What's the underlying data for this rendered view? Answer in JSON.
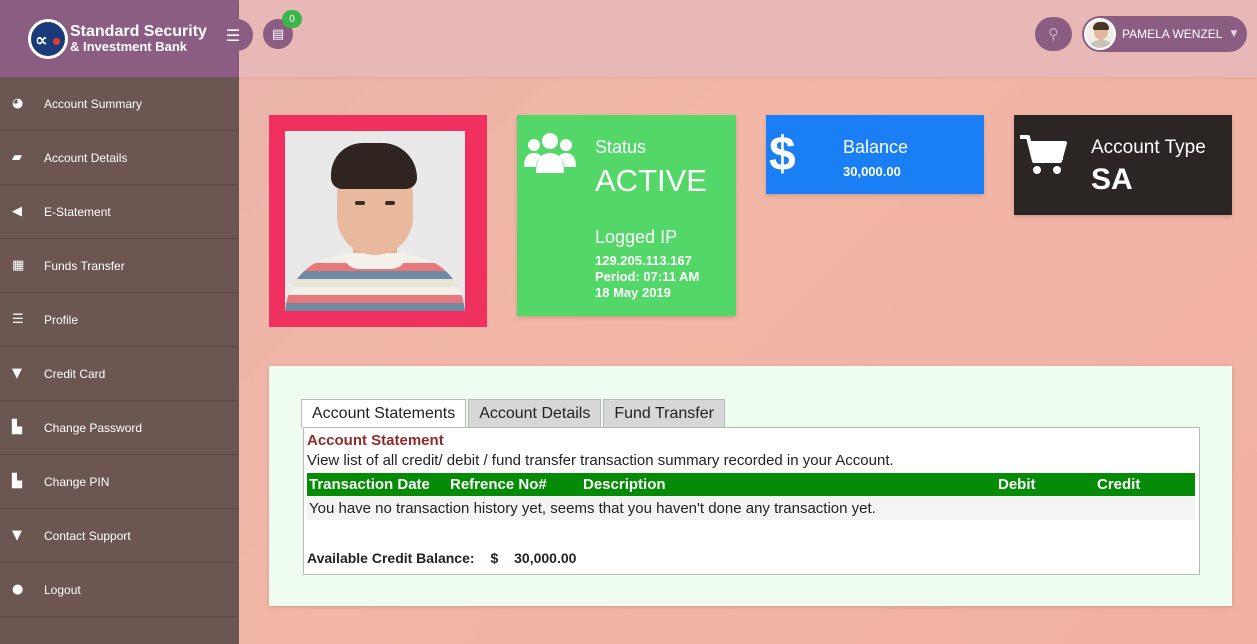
{
  "brand": {
    "line1": "Standard Security",
    "line2": "& Investment Bank"
  },
  "topbar": {
    "notification_count": "0",
    "user_name": "PAMELA WENZEL"
  },
  "sidebar": {
    "items": [
      {
        "label": "Account Summary",
        "icon": "dashboard-icon"
      },
      {
        "label": "Account Details",
        "icon": "book-icon"
      },
      {
        "label": "E-Statement",
        "icon": "megaphone-icon"
      },
      {
        "label": "Funds Transfer",
        "icon": "grid-icon"
      },
      {
        "label": "Profile",
        "icon": "list-icon"
      },
      {
        "label": "Credit Card",
        "icon": "glass-icon"
      },
      {
        "label": "Change Password",
        "icon": "bar-chart-icon"
      },
      {
        "label": "Change PIN",
        "icon": "bar-chart-icon"
      },
      {
        "label": "Contact Support",
        "icon": "glass-icon"
      },
      {
        "label": "Logout",
        "icon": "user-icon"
      }
    ]
  },
  "cards": {
    "status": {
      "title": "Status",
      "value": "ACTIVE",
      "ip_title": "Logged IP",
      "ip": "129.205.113.167",
      "period": "Period: 07:11 AM",
      "date": "18 May 2019"
    },
    "balance": {
      "title": "Balance",
      "value": "30,000.00"
    },
    "account_type": {
      "title": "Account Type",
      "value": "SA"
    }
  },
  "colors": {
    "photo_frame": "#f0315f",
    "status": "#53d769",
    "balance": "#1a7ef5",
    "account_type": "#2b2624",
    "table_header": "#058b06"
  },
  "tabs": [
    {
      "label": "Account Statements",
      "active": true
    },
    {
      "label": "Account Details",
      "active": false
    },
    {
      "label": "Fund Transfer",
      "active": false
    }
  ],
  "statement": {
    "title": "Account Statement",
    "description": "View list of all credit/ debit / fund transfer transaction summary recorded in your Account.",
    "columns": [
      "Transaction Date",
      "Refrence No#",
      "Description",
      "Debit",
      "Credit"
    ],
    "empty_message": "You have no transaction history yet, seems that you haven't done any transaction yet.",
    "available_label": "Available Credit Balance:",
    "currency": "$",
    "available_amount": "30,000.00"
  }
}
